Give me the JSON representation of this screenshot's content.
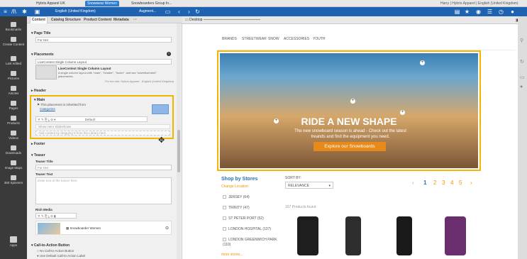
{
  "topbar": {
    "tabs": [
      "Hybris Apparel UK",
      "Snowwear Women",
      "Snowboarders Group In..."
    ],
    "user": "Harry | Hybris Apparel | English (United Kingdom)"
  },
  "navbar": {
    "site_label": "English (United Kingdom)",
    "augment_label": "Augment..."
  },
  "leftnav": [
    "Bookmarks",
    "Create Content",
    "Last edited",
    "Pictures",
    "Articles",
    "Pages",
    "Products",
    "Videos",
    "Downloads",
    "Image Maps",
    "360 Spinners",
    "Apps"
  ],
  "panel": {
    "tabs": [
      "Content",
      "Catalog Structure",
      "Product Content",
      "Metadata",
      "···"
    ],
    "page_title_label": "Page Title",
    "page_title_value": "For Her",
    "placements_label": "Placements",
    "layout_value": "LiveContext Single Column Layout",
    "layout_desc_title": "LiveContext Single Column Layout",
    "layout_desc": "A single column layout with \"main\", \"header\", \"footer\", and two \"advertisement\" placements.",
    "layout_site": "For the site: Hybris Apparel - English (United Kingdom)",
    "header_label": "Header",
    "main_label": "Main",
    "inherited_text": "This placement is inherited from",
    "inherited_link": "Categories",
    "default_label": "Default",
    "show_hero": "Show Hero Slideshows",
    "add_content": "Add content by dragging it from the Library here",
    "footer_label": "Footer",
    "teaser_label": "Teaser",
    "teaser_title_label": "Teaser Title",
    "teaser_title_value": "For Her",
    "teaser_text_label": "Teaser Text",
    "teaser_text_placeholder": "Enter text of the teaser here",
    "rich_media_label": "Rich Media",
    "rich_media_item": "Snowboarder Women",
    "cta_label": "Call-to-Action Button",
    "cta_opt1": "No Call-to-Action Button",
    "cta_opt2": "Use Default Call-to-Action Label"
  },
  "browser": {
    "device": "Desktop",
    "menu": [
      "BRANDS",
      "STREETWEAR",
      "SNOW",
      "ACCESSORIES",
      "YOUTH"
    ],
    "hero_title": "RIDE A NEW SHAPE",
    "hero_text": "The new snowboard season is ahead - Check out the latest treands and find the equipment you need.",
    "hero_button": "Explore our Snowboards",
    "shop_by_stores": "Shop by Stores",
    "change_location": "Change Location",
    "stores": [
      "JERSEY (64)",
      "TRINITY (47)",
      "ST PETER PORT (52)",
      "LONDON HOSPITAL (137)",
      "LONDON GREENWICH PARK (110)"
    ],
    "more_stores": "more stores...",
    "sort_by": "SORT BY:",
    "sort_value": "RELEVANCE",
    "pages": [
      "1",
      "2",
      "3",
      "4",
      "5"
    ],
    "products_found": "157 Products found"
  },
  "colors": {
    "accent": "#1d63b1",
    "highlight": "#f5b400",
    "orange": "#f59300"
  }
}
